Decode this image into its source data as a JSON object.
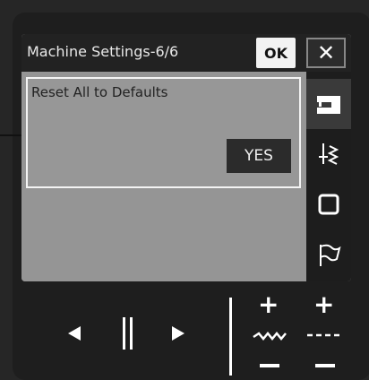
{
  "header": {
    "title": "Machine Settings-6/6",
    "ok_label": "OK",
    "close_label": "✕"
  },
  "setting": {
    "label": "Reset All to Defaults",
    "yes_label": "YES"
  },
  "side_tabs": [
    {
      "name": "machine-settings",
      "icon": "sewing-machine-icon",
      "active": true
    },
    {
      "name": "stitch-settings",
      "icon": "stitch-needle-icon",
      "active": false
    },
    {
      "name": "embroidery-settings",
      "icon": "hoop-frame-icon",
      "active": false
    },
    {
      "name": "general-settings",
      "icon": "flag-icon",
      "active": false
    }
  ],
  "controls": {
    "previous_icon": "triangle-left-icon",
    "pause_icon": "pause-bars-icon",
    "next_icon": "triangle-right-icon",
    "stitch_width": {
      "increase": "+",
      "decrease": "−",
      "icon": "zigzag-width-icon"
    },
    "stitch_length": {
      "increase": "+",
      "decrease": "−",
      "icon": "dashed-length-icon"
    }
  },
  "colors": {
    "screen_background": "#9a9a9a",
    "title_bar": "#222222",
    "highlight_border": "#f4f4f4",
    "bezel": "#1e1e1e"
  }
}
